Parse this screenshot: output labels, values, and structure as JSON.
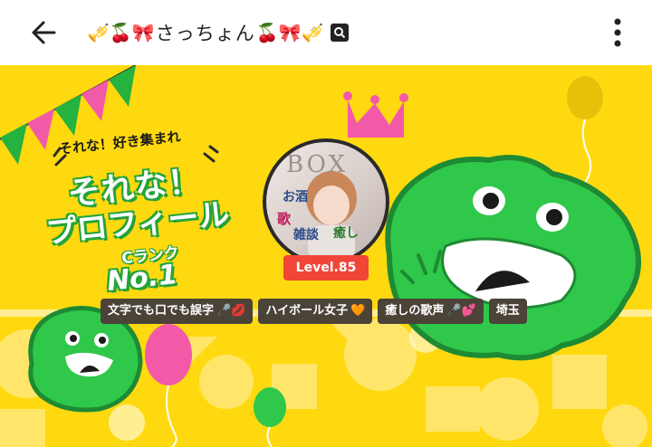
{
  "header": {
    "back_icon": "arrow-left-icon",
    "title_prefix_emoji": "🎺🍒🎀",
    "title_text": "さっちょん",
    "title_suffix_emoji": "🍒🎀🎺",
    "title_badge_icon": "search-icon",
    "menu_icon": "more-vertical-icon"
  },
  "banner": {
    "promo_line1": "それな！好き集まれ",
    "promo_line2": "それな！",
    "promo_line3": "プロフィール",
    "promo_rank": "Cランク",
    "promo_no": "No.1",
    "avatar_text": "BOX",
    "avatar_caption1": "お酒",
    "avatar_caption2": "歌",
    "avatar_caption3": "雑談",
    "avatar_caption4": "癒し",
    "level_label": "Level.85",
    "colors": {
      "bg": "#ffd90f",
      "frog_green": "#2fc84a",
      "level_red": "#f04638",
      "tag_bg": "#4b4338",
      "crown": "#f25aa8"
    }
  },
  "tags": [
    {
      "label": "文字でも口でも誤字",
      "emoji": "🎤💋"
    },
    {
      "label": "ハイボール女子",
      "emoji": "🧡"
    },
    {
      "label": "癒しの歌声",
      "emoji": "🎤💕"
    },
    {
      "label": "埼玉",
      "emoji": ""
    }
  ]
}
